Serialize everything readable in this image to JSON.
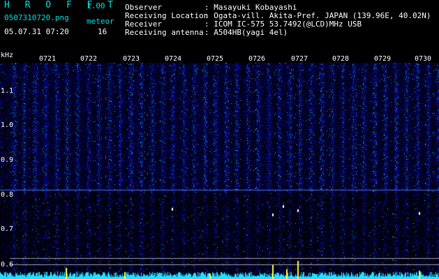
{
  "header": {
    "app_title": "H R O F F T",
    "version": "1.00",
    "filename": "0507310720.png",
    "meteor_label": "meteor",
    "meteor_count": "16",
    "datetime": "05.07.31 07:20",
    "info": [
      {
        "label": "Observer",
        "value": ": Masayuki Kobayashi"
      },
      {
        "label": "Receiving Location",
        "value": ": Ogata-vill. Akita-Pref. JAPAN (139.96E, 40.02N)"
      },
      {
        "label": "Receiver",
        "value": ": ICOM IC-575 53.7492(@LCD)MHz USB"
      },
      {
        "label": "Receiving antenna",
        "value": ": A504HB(yagi 4el)"
      }
    ]
  },
  "axis": {
    "unit": "kHz",
    "y_ticks": [
      "1.1",
      "1.0",
      "0.9",
      "0.8",
      "0.7",
      "0.6"
    ],
    "time_ticks": [
      "0721",
      "0722",
      "0723",
      "0724",
      "0725",
      "0726",
      "0727",
      "0728",
      "0729",
      "0730"
    ]
  },
  "colors": {
    "background": "#000000",
    "spectrum_base": "#0a1a8c",
    "spectrum_hot": "#22e0ff",
    "signal": "#ffff40",
    "text_cyan": "#00e0e0",
    "text_white": "#ffffff"
  }
}
